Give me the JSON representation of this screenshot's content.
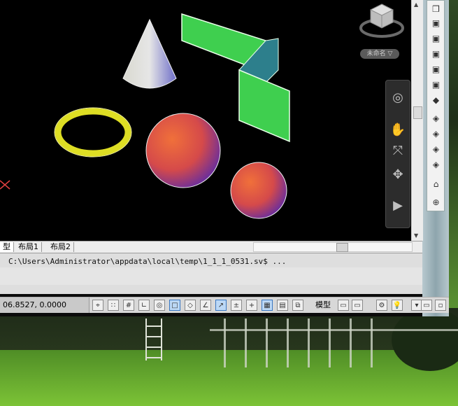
{
  "layout_tabs": [
    {
      "label": "型"
    },
    {
      "label": "布局1"
    },
    {
      "label": "布局2"
    }
  ],
  "viewcube": {
    "label": "未命名 ▽"
  },
  "command_line": {
    "history": "C:\\Users\\Administrator\\appdata\\local\\temp\\1_1_1_0531.sv$ ..."
  },
  "status_bar": {
    "coordinates": "06.8527, 0.0000",
    "model_label": "模型"
  },
  "icons": {
    "view_toolbar": [
      "cube-view-icon",
      "cube-front-icon",
      "cube-left-icon",
      "cube-right-icon",
      "cube-back-icon",
      "cube-top-icon",
      "cube-bottom-icon",
      "iso-sw-icon",
      "iso-se-icon",
      "iso-ne-icon",
      "iso-nw-icon",
      "camera-icon",
      "zoom-icon"
    ],
    "navbar": [
      "steering-wheel-icon",
      "pan-icon",
      "zoom-extents-icon",
      "orbit-icon",
      "showmotion-icon"
    ]
  },
  "colors": {
    "viewport_bg": "#000000",
    "box_green": "#3fcf4f",
    "box_side": "#2f8a8f",
    "torus_yellow": "#e6e62a",
    "sphere_orange": "#e8553a",
    "sphere_purple": "#6a2fa8",
    "cone_light": "#e0e0e0"
  }
}
